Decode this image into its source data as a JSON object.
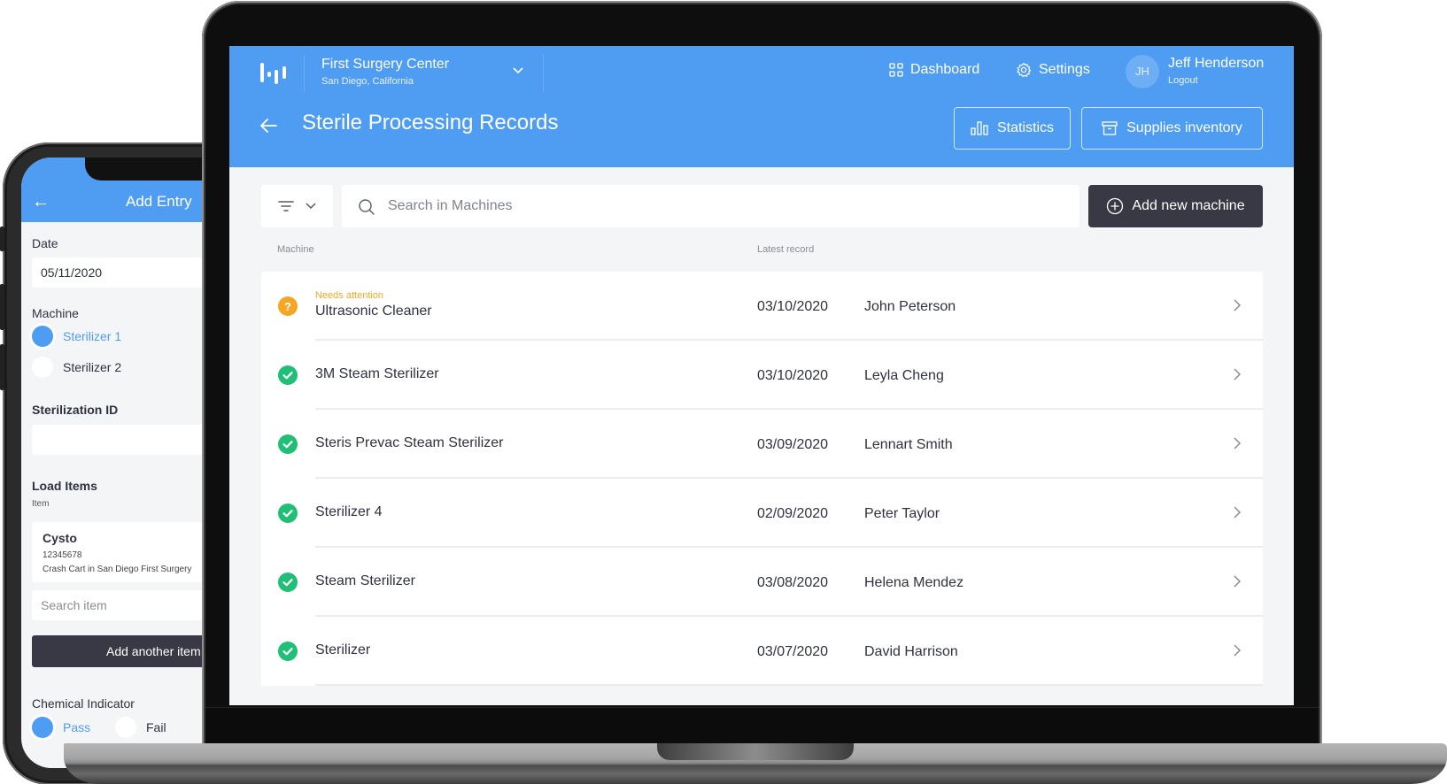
{
  "phone": {
    "header_title": "Add Entry",
    "date_label": "Date",
    "date_value": "05/11/2020",
    "machine_label": "Machine",
    "machine_options": [
      {
        "label": "Sterilizer 1",
        "selected": true
      },
      {
        "label": "Sterilizer 2",
        "selected": false
      }
    ],
    "sterilization_id_label": "Sterilization ID",
    "sterilization_id_value": "",
    "load_items_label": "Load Items",
    "item_sublabel": "Item",
    "item_card": {
      "name": "Cysto",
      "code": "12345678",
      "location": "Crash Cart in San Diego First Surgery"
    },
    "search_item_placeholder": "Search item",
    "add_item_button": "Add another item",
    "chemical_indicator_label": "Chemical Indicator",
    "chemical_options": [
      {
        "label": "Pass",
        "selected": true
      },
      {
        "label": "Fail",
        "selected": false
      }
    ]
  },
  "app": {
    "org": {
      "name": "First Surgery Center",
      "location": "San Diego, California"
    },
    "nav": {
      "dashboard": "Dashboard",
      "settings": "Settings"
    },
    "user": {
      "initials": "JH",
      "name": "Jeff Henderson",
      "logout": "Logout"
    },
    "page_title": "Sterile Processing Records",
    "buttons": {
      "statistics": "Statistics",
      "supplies": "Supplies inventory",
      "add_machine": "Add new machine"
    },
    "search": {
      "placeholder": "Search in Machines",
      "value": ""
    },
    "columns": {
      "machine": "Machine",
      "latest_record": "Latest record"
    },
    "colors": {
      "brand": "#4f9df2",
      "ok": "#1fbf75",
      "attention": "#f5a623",
      "dark_button": "#383944"
    },
    "machines": [
      {
        "status": "attention",
        "status_label": "Needs attention",
        "name": "Ultrasonic Cleaner",
        "date": "03/10/2020",
        "person": "John Peterson"
      },
      {
        "status": "ok",
        "status_label": "",
        "name": "3M Steam Sterilizer",
        "date": "03/10/2020",
        "person": "Leyla Cheng"
      },
      {
        "status": "ok",
        "status_label": "",
        "name": "Steris Prevac Steam Sterilizer",
        "date": "03/09/2020",
        "person": "Lennart Smith"
      },
      {
        "status": "ok",
        "status_label": "",
        "name": "Sterilizer 4",
        "date": "02/09/2020",
        "person": "Peter Taylor"
      },
      {
        "status": "ok",
        "status_label": "",
        "name": "Steam Sterilizer",
        "date": "03/08/2020",
        "person": "Helena Mendez"
      },
      {
        "status": "ok",
        "status_label": "",
        "name": "Sterilizer",
        "date": "03/07/2020",
        "person": "David Harrison"
      }
    ]
  }
}
